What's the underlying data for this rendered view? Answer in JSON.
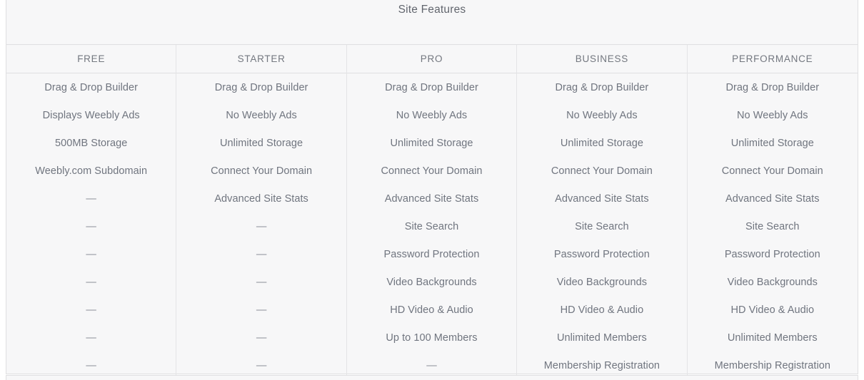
{
  "table": {
    "title": "Site Features",
    "columns": [
      "FREE",
      "STARTER",
      "PRO",
      "BUSINESS",
      "PERFORMANCE"
    ],
    "empty_marker": "—",
    "rows": [
      [
        "Drag & Drop Builder",
        "Drag & Drop Builder",
        "Drag & Drop Builder",
        "Drag & Drop Builder",
        "Drag & Drop Builder"
      ],
      [
        "Displays Weebly Ads",
        "No Weebly Ads",
        "No Weebly Ads",
        "No Weebly Ads",
        "No Weebly Ads"
      ],
      [
        "500MB Storage",
        "Unlimited Storage",
        "Unlimited Storage",
        "Unlimited Storage",
        "Unlimited Storage"
      ],
      [
        "Weebly.com Subdomain",
        "Connect Your Domain",
        "Connect Your Domain",
        "Connect Your Domain",
        "Connect Your Domain"
      ],
      [
        "—",
        "Advanced Site Stats",
        "Advanced Site Stats",
        "Advanced Site Stats",
        "Advanced Site Stats"
      ],
      [
        "—",
        "—",
        "Site Search",
        "Site Search",
        "Site Search"
      ],
      [
        "—",
        "—",
        "Password Protection",
        "Password Protection",
        "Password Protection"
      ],
      [
        "—",
        "—",
        "Video Backgrounds",
        "Video Backgrounds",
        "Video Backgrounds"
      ],
      [
        "—",
        "—",
        "HD Video & Audio",
        "HD Video & Audio",
        "HD Video & Audio"
      ],
      [
        "—",
        "—",
        "Up to 100 Members",
        "Unlimited Members",
        "Unlimited Members"
      ],
      [
        "—",
        "—",
        "—",
        "Membership Registration",
        "Membership Registration"
      ]
    ]
  },
  "colors": {
    "panel_background": "#f7f7f8",
    "border": "#dfdfe1",
    "title_text": "#62666e",
    "header_text": "#73777f",
    "body_text": "#70757f"
  }
}
